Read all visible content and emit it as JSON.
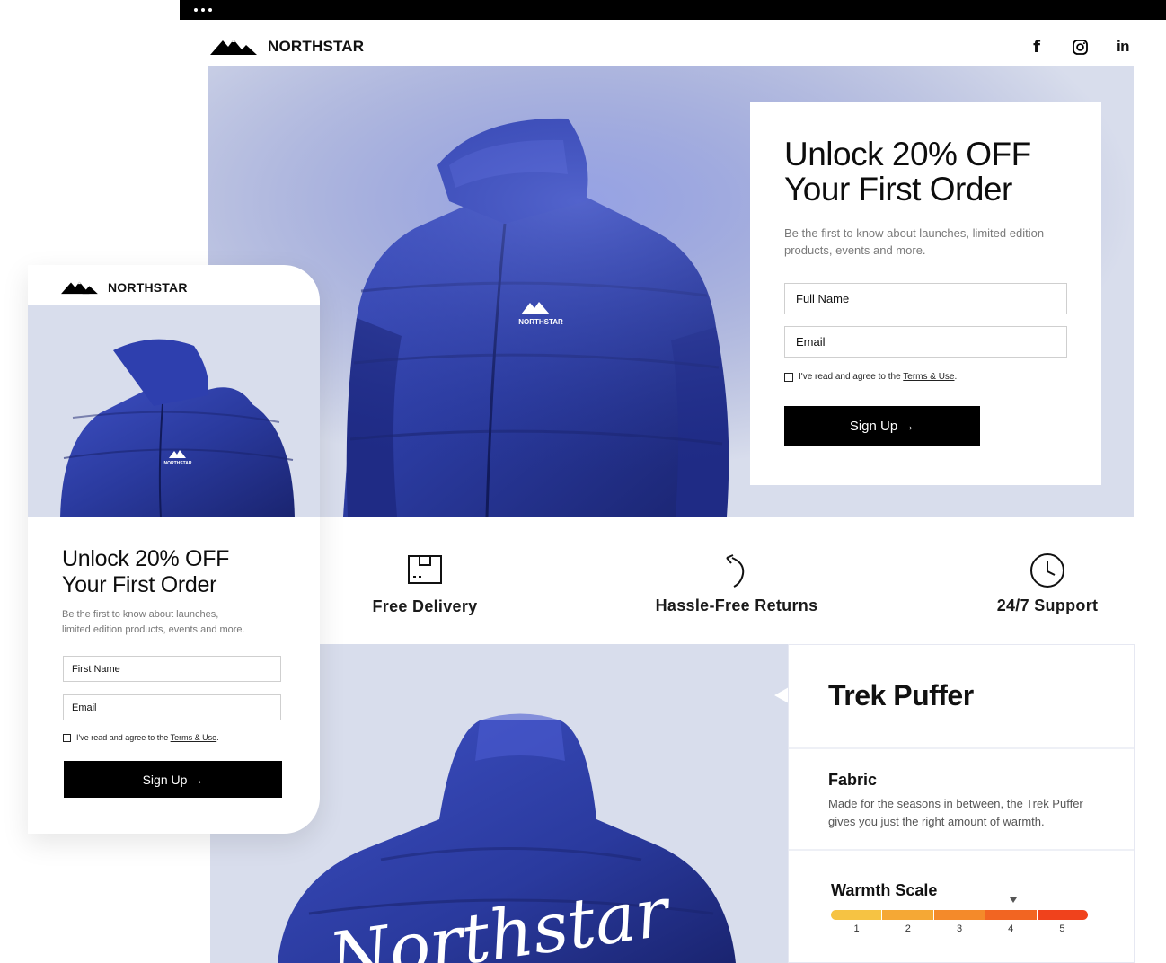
{
  "brand": {
    "name": "NORTHSTAR",
    "logo_icon": "mountain-logo-icon"
  },
  "social": [
    {
      "name": "facebook",
      "glyph": "f"
    },
    {
      "name": "instagram",
      "glyph": ""
    },
    {
      "name": "linkedin",
      "glyph": "in"
    }
  ],
  "hero": {
    "chest_logo": "NORTHSTAR",
    "headline_line1": "Unlock 20% OFF",
    "headline_line2": "Your First Order",
    "subtext": "Be the first to know about launches, limited edition products, events and more.",
    "name_placeholder": "Full Name",
    "email_placeholder": "Email",
    "agree_text": "I've read and agree to the ",
    "terms_text": "Terms & Use",
    "agree_end": ".",
    "signup_label": "Sign Up",
    "signup_arrow": "→"
  },
  "features": [
    {
      "label": "Free Delivery",
      "icon": "package-icon"
    },
    {
      "label": "Hassle-Free Returns",
      "icon": "return-arrow-icon"
    },
    {
      "label": "24/7 Support",
      "icon": "clock-icon"
    }
  ],
  "product": {
    "title": "Trek Puffer",
    "fabric_heading": "Fabric",
    "fabric_text": "Made for the seasons in between, the Trek Puffer gives you just the right amount of warmth.",
    "warmth_heading": "Warmth Scale",
    "warmth_ticks": [
      "1",
      "2",
      "3",
      "4",
      "5"
    ],
    "warmth_value": 4,
    "back_script": "Northstar"
  },
  "mobile": {
    "brand_name": "NORTHSTAR",
    "chest_logo": "NORTHSTAR",
    "headline_line1": "Unlock 20% OFF",
    "headline_line2": "Your First Order",
    "subtext_line1": "Be the first to know about launches,",
    "subtext_line2": "limited edition products, events and more.",
    "name_placeholder": "First Name",
    "email_placeholder": "Email",
    "agree_text": "I've read and agree to the ",
    "terms_text": "Terms & Use",
    "agree_end": ".",
    "signup_label": "Sign Up",
    "signup_arrow": "→"
  },
  "colors": {
    "hero_bg": "#d8ddec",
    "jacket_blue": "#2a3a9e",
    "warmth_start": "#f6c343",
    "warmth_end": "#f0421c"
  }
}
